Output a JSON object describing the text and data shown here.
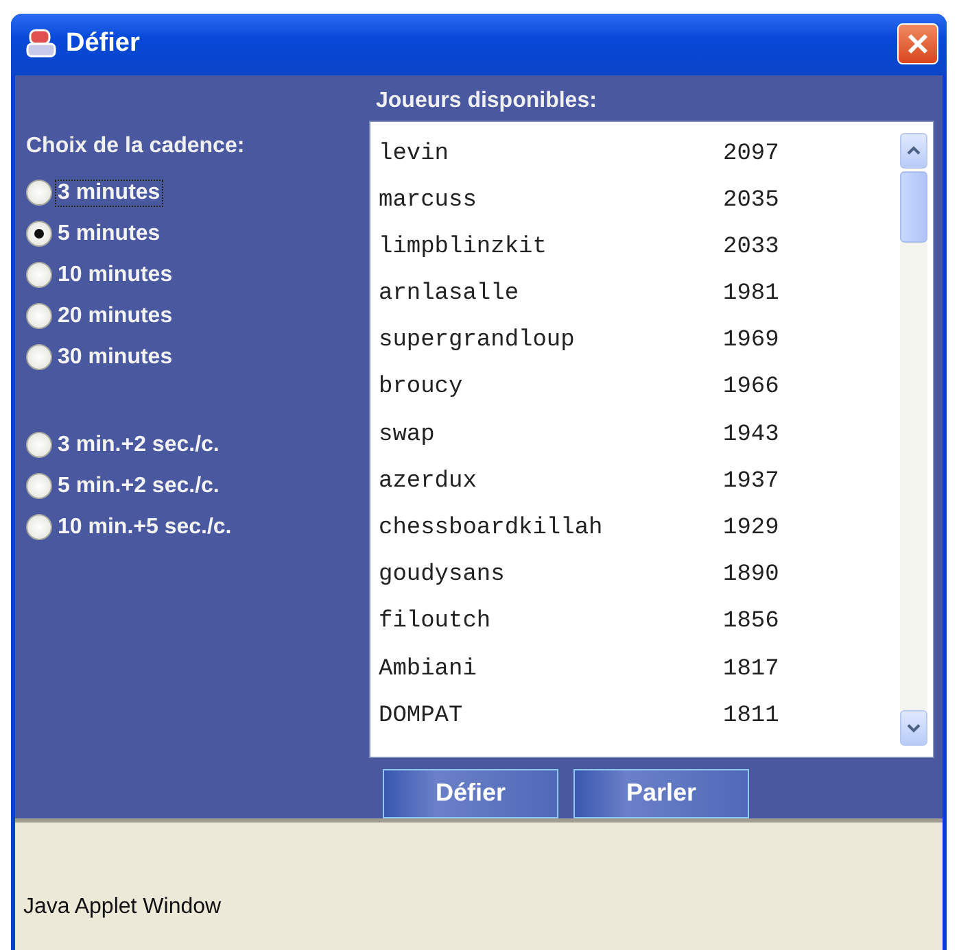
{
  "window": {
    "title": "Défier"
  },
  "cadence": {
    "label": "Choix de la cadence:",
    "groups": [
      [
        {
          "label": "3 minutes",
          "selected": false,
          "focused": true
        },
        {
          "label": "5 minutes",
          "selected": true,
          "focused": false
        },
        {
          "label": "10 minutes",
          "selected": false,
          "focused": false
        },
        {
          "label": "20 minutes",
          "selected": false,
          "focused": false
        },
        {
          "label": "30 minutes",
          "selected": false,
          "focused": false
        }
      ],
      [
        {
          "label": "3 min.+2 sec./c.",
          "selected": false,
          "focused": false
        },
        {
          "label": "5 min.+2 sec./c.",
          "selected": false,
          "focused": false
        },
        {
          "label": "10 min.+5 sec./c.",
          "selected": false,
          "focused": false
        }
      ]
    ]
  },
  "players": {
    "label": "Joueurs disponibles:",
    "rows": [
      {
        "name": "levin",
        "rating": "2097"
      },
      {
        "name": "marcuss",
        "rating": "2035"
      },
      {
        "name": "limpblinzkit",
        "rating": "2033"
      },
      {
        "name": "arnlasalle",
        "rating": "1981"
      },
      {
        "name": "supergrandloup",
        "rating": "1969"
      },
      {
        "name": "broucy",
        "rating": "1966"
      },
      {
        "name": "swap",
        "rating": "1943"
      },
      {
        "name": "azerdux",
        "rating": "1937"
      },
      {
        "name": "chessboardkillah",
        "rating": "1929"
      },
      {
        "name": "goudysans",
        "rating": "1890"
      },
      {
        "name": "filoutch",
        "rating": "1856"
      },
      {
        "name": "Ambiani",
        "rating": "1817"
      },
      {
        "name": "DOMPAT",
        "rating": "1811"
      }
    ]
  },
  "buttons": [
    "Défier",
    "Parler"
  ],
  "status_bar": "Java Applet Window"
}
